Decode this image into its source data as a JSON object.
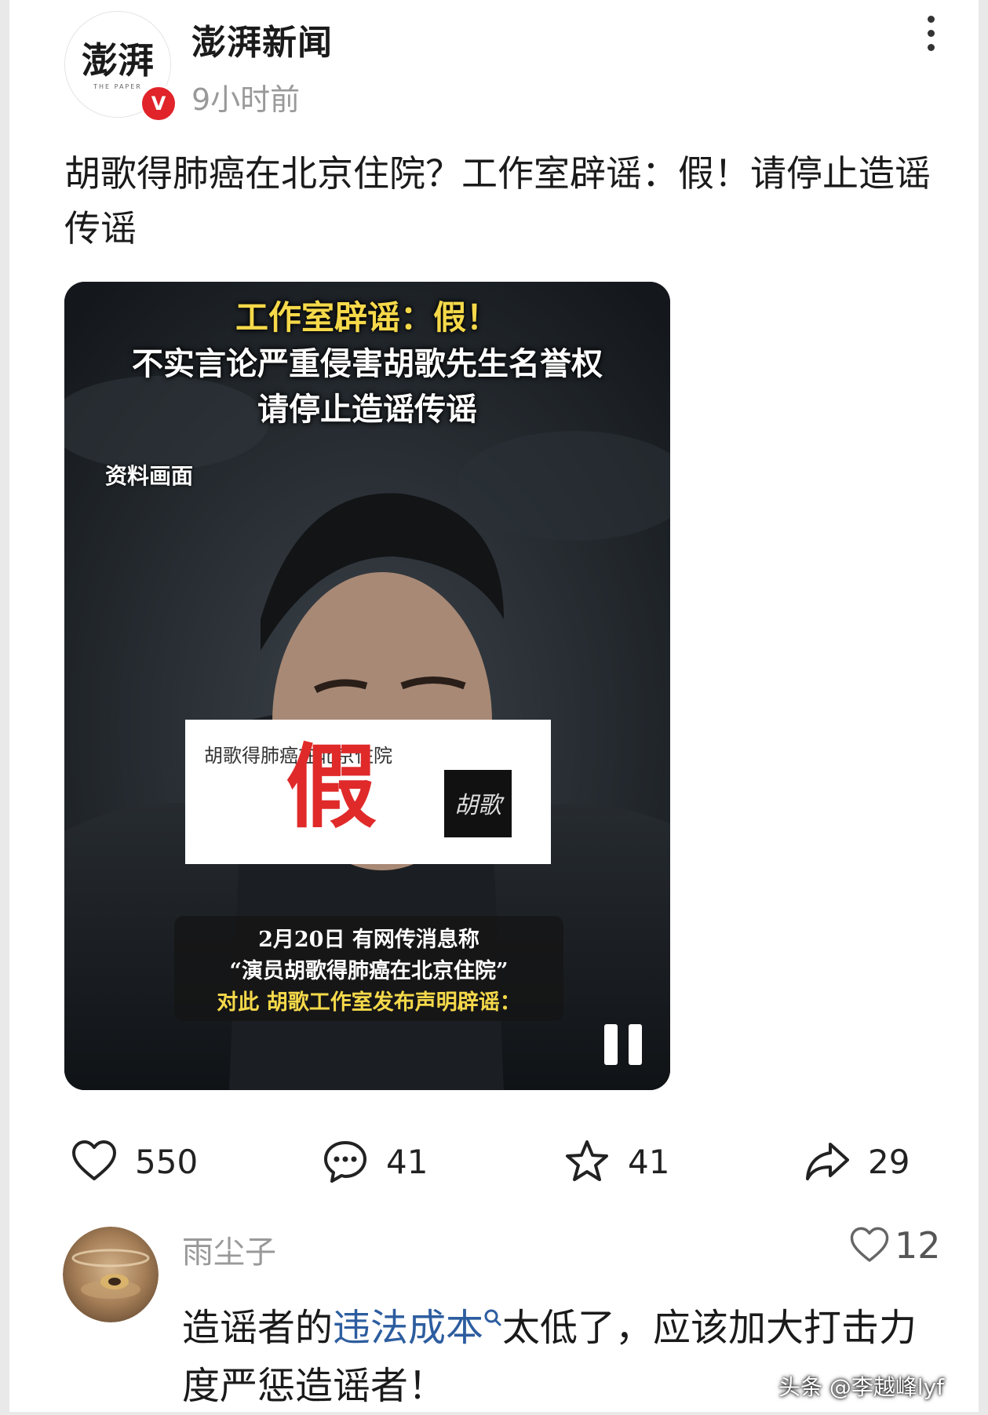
{
  "post": {
    "account_name": "澎湃新闻",
    "avatar_logo_text": "澎湃",
    "avatar_logo_sub": "THE PAPER",
    "verified_badge": "V",
    "time": "9小时前",
    "title": "胡歌得肺癌在北京住院？工作室辟谣：假！请停止造谣传谣"
  },
  "video": {
    "headline": "工作室辟谣：假！",
    "line1": "不实言论严重侵害胡歌先生名誉权",
    "line2": "请停止造谣传谣",
    "archive_label": "资料画面",
    "card_text": "胡歌得肺癌在北京住院",
    "card_big": "假",
    "signature_text": "胡歌",
    "caption1": "2月20日 有网传消息称",
    "caption2": "“演员胡歌得肺癌在北京住院”",
    "caption3": "对此 胡歌工作室发布声明辟谣："
  },
  "actions": {
    "like": "550",
    "comment": "41",
    "favorite": "41",
    "share": "29"
  },
  "comment": {
    "user": "雨尘子",
    "likes": "12",
    "text_before": "造谣者的",
    "link": "违法成本",
    "text_after": "太低了，应该加大打击力度严惩造谣者！"
  },
  "watermark": "头条 @李越峰lyf",
  "colors": {
    "accent_red": "#e0242a",
    "link_blue": "#2d5d9f",
    "headline_yellow": "#f5d94a"
  },
  "icons": [
    "more-vertical-icon",
    "heart-icon",
    "comment-icon",
    "star-icon",
    "share-icon",
    "pause-icon",
    "search-icon"
  ]
}
